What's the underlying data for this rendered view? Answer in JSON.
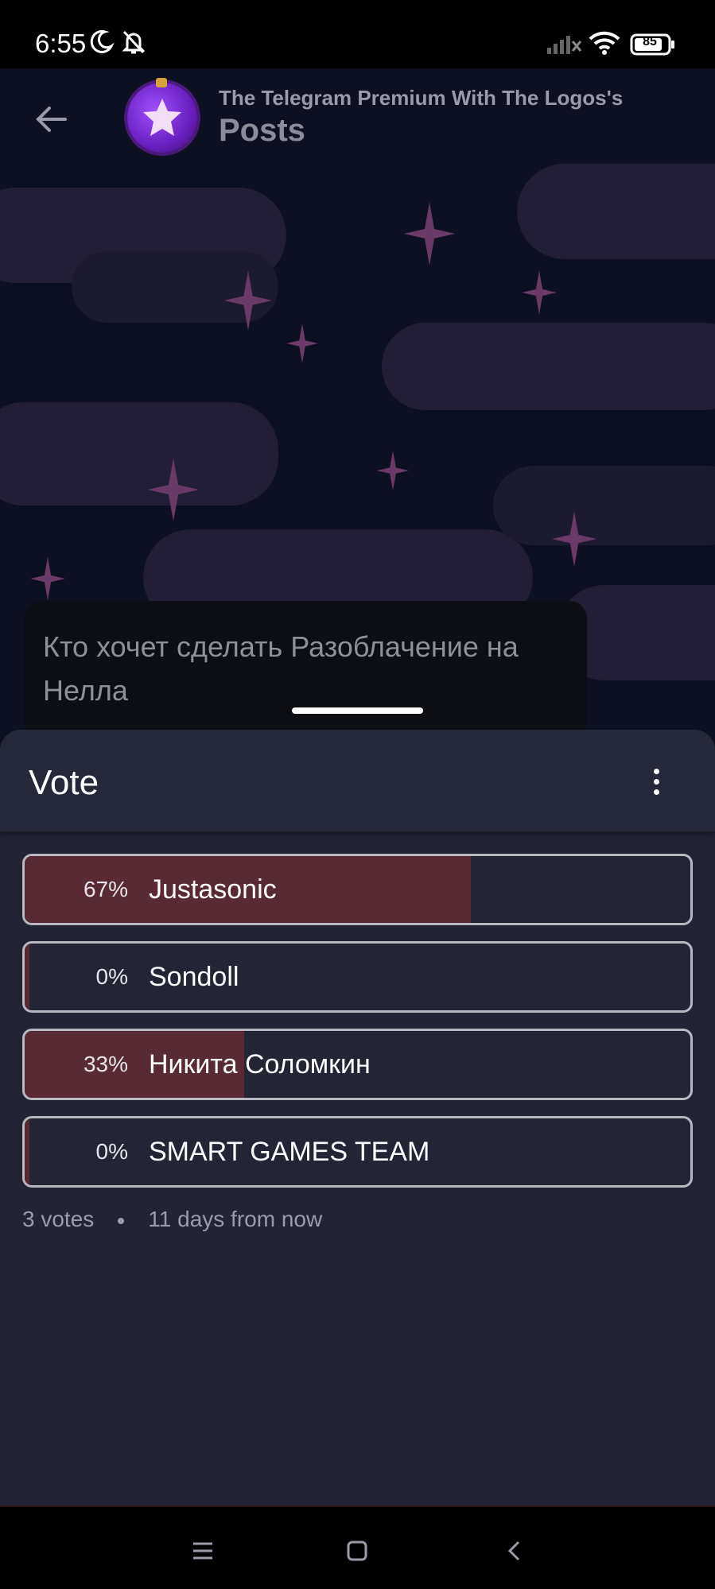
{
  "status_bar": {
    "time": "6:55",
    "battery": "85",
    "icons": [
      "moon-icon",
      "bell-off-icon",
      "signal-icon",
      "wifi-icon",
      "battery-icon"
    ]
  },
  "header": {
    "channel_name": "The Telegram Premium With The Logos's",
    "subtitle": "Posts",
    "back_icon": "arrow-left-icon"
  },
  "message": {
    "text": "Кто хочет сделать Разоблачение на Нелла"
  },
  "poll": {
    "title": "Vote",
    "options": [
      {
        "percent_label": "67%",
        "label": "Justasonic",
        "fraction": 0.67
      },
      {
        "percent_label": "0%",
        "label": "Sondoll",
        "fraction": 0.0
      },
      {
        "percent_label": "33%",
        "label": "Никита Соломкин",
        "fraction": 0.33
      },
      {
        "percent_label": "0%",
        "label": "SMART GAMES TEAM",
        "fraction": 0.0
      }
    ],
    "votes": "3 votes",
    "time_left": "11 days from now"
  },
  "colors": {
    "sheet_bg": "#222433",
    "fill": "#5a2a34",
    "border": "#b8b8c0"
  },
  "navbar": {
    "icons": [
      "menu-icon",
      "home-square-icon",
      "back-chevron-icon"
    ]
  }
}
